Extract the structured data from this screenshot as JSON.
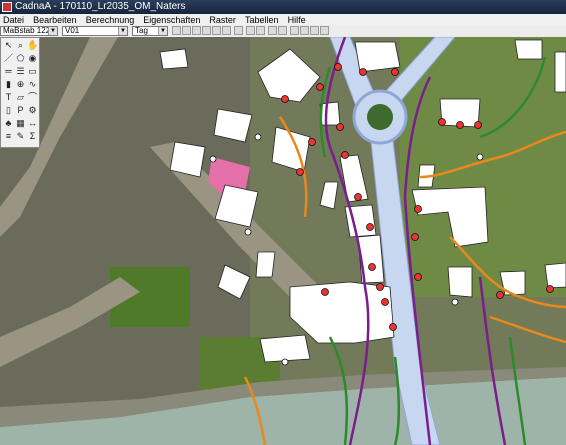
{
  "window": {
    "title": "CadnaA - 170110_Lr2035_OM_Naters"
  },
  "menu": [
    "Datei",
    "Bearbeiten",
    "Berechnung",
    "Eigenschaften",
    "Raster",
    "Tabellen",
    "Hilfe"
  ],
  "toolbar": {
    "scale_value": "MaBstab 1222",
    "layer_value": "V01",
    "time_value": "Tag"
  },
  "palette_icons": [
    "pointer-icon",
    "zoom-icon",
    "pan-icon",
    "line-icon",
    "polygon-icon",
    "point-source-icon",
    "road-icon",
    "rail-icon",
    "building-icon",
    "wall-icon",
    "receiver-icon",
    "contour-icon",
    "text-icon",
    "area-icon",
    "bridge-icon",
    "barrier-icon",
    "parking-icon",
    "industry-icon",
    "tree-icon",
    "grid-icon",
    "measure-icon",
    "layer-icon",
    "label-icon",
    "calc-icon"
  ],
  "colors": {
    "road": "#c7d7f0",
    "building": "#ffffff",
    "contour_orange": "#e8891e",
    "contour_green": "#2c8a2c",
    "contour_purple": "#7a1e8c",
    "river": "#9fb4a8"
  }
}
